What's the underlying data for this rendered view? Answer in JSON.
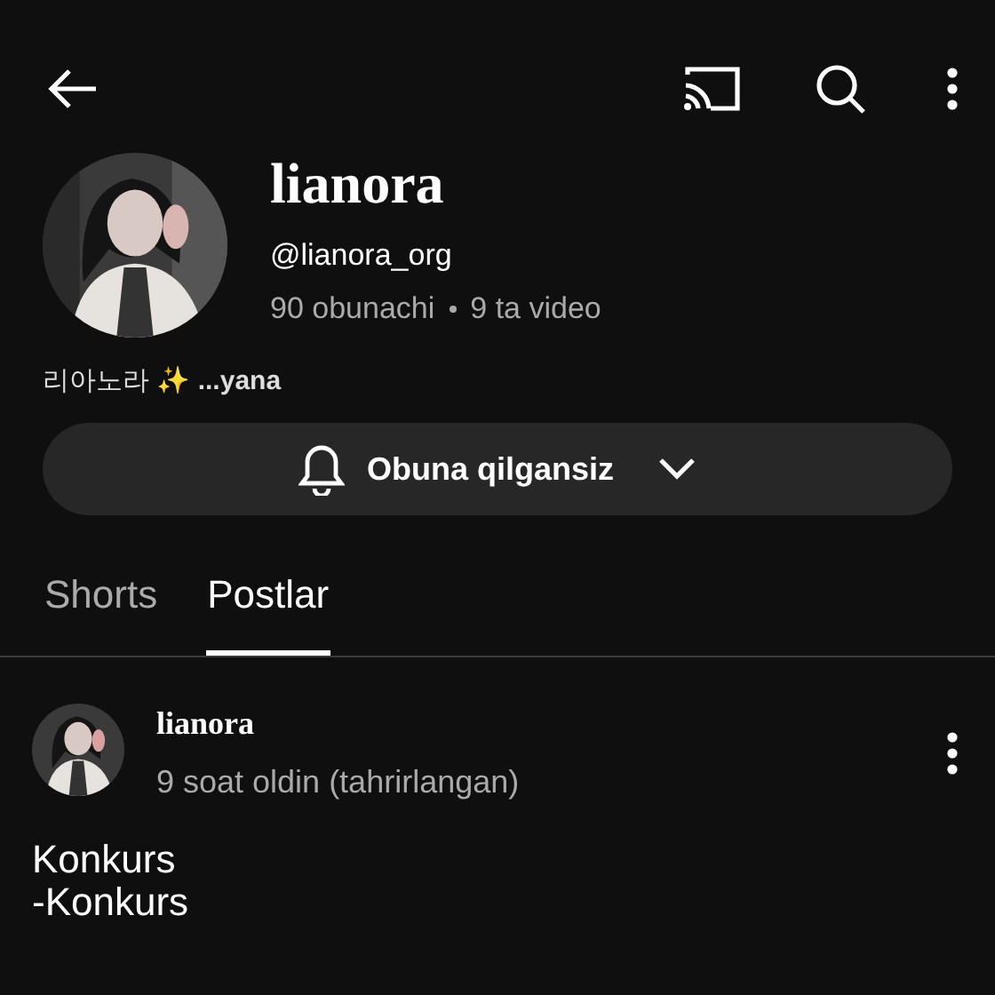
{
  "channel": {
    "name": "lianora",
    "handle": "@lianora_org",
    "subscribers": "90 obunachi",
    "videos": "9 ta video",
    "bio": "리아노라 ✨ **...yana**"
  },
  "subscribe_button": {
    "label": "Obuna qilgansiz"
  },
  "tabs": [
    {
      "label": "Shorts",
      "selected": false
    },
    {
      "label": "Postlar",
      "selected": true
    }
  ],
  "post": {
    "author": "lianora",
    "time": "9 soat oldin (tahrirlangan)",
    "lines": [
      "Konkurs",
      "-Konkurs"
    ]
  }
}
